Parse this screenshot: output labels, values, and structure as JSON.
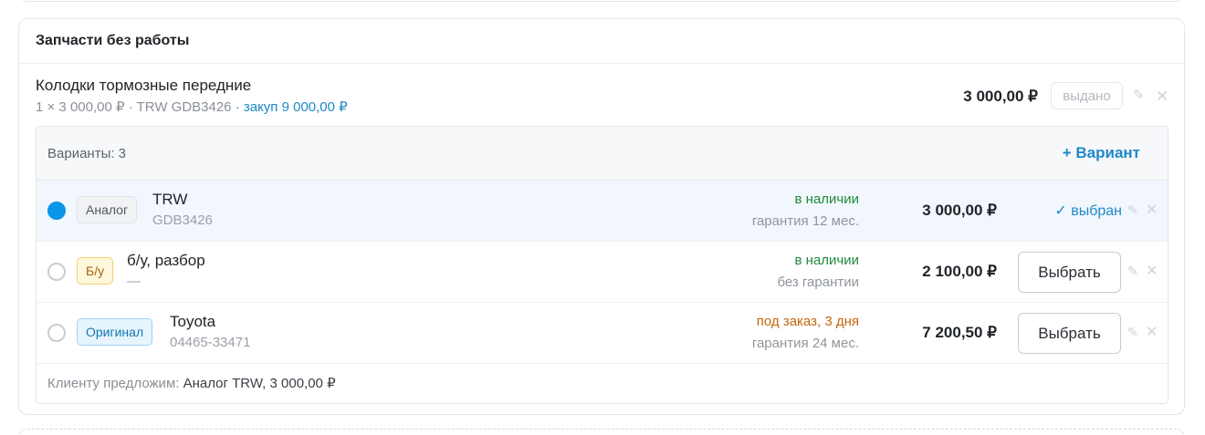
{
  "section": {
    "title": "Запчасти без работы"
  },
  "part": {
    "name": "Колодки тормозные передние",
    "meta_main": "1 × 3 000,00 ₽ · TRW GDB3426",
    "meta_buy": " · закуп 9 000,00 ₽",
    "price": "3 000,00 ₽",
    "issued_label": "выдано",
    "edit_icon": "✎",
    "delete_icon": "✕"
  },
  "variants": {
    "count_label": "Варианты: 3",
    "add_label": "+ Вариант",
    "rows": [
      {
        "selected": true,
        "tag": "Аналог",
        "name": "TRW",
        "code": "GDB3426",
        "status": "в наличии",
        "warranty": "гарантия 12 мес.",
        "price": "3 000,00 ₽",
        "chosen_label": "✓ выбран"
      },
      {
        "selected": false,
        "tag": "Б/у",
        "name": "б/у, разбор",
        "code": "—",
        "status": "в наличии",
        "warranty": "без гарантии",
        "price": "2 100,00 ₽",
        "choose_label": "Выбрать"
      },
      {
        "selected": false,
        "tag": "Оригинал",
        "name": "Toyota",
        "code": "04465-33471",
        "status": "под заказ, 3 дня",
        "warranty": "гарантия 24 мес.",
        "price": "7 200,50 ₽",
        "choose_label": "Выбрать"
      }
    ],
    "footer_label": "Клиенту предложим: ",
    "footer_value": "Аналог TRW, 3 000,00 ₽"
  },
  "colors": {
    "accent": "#1e88c7",
    "radio_selected": "#0a95e8",
    "in_stock": "#1f8a3b",
    "on_order": "#c2650d"
  }
}
